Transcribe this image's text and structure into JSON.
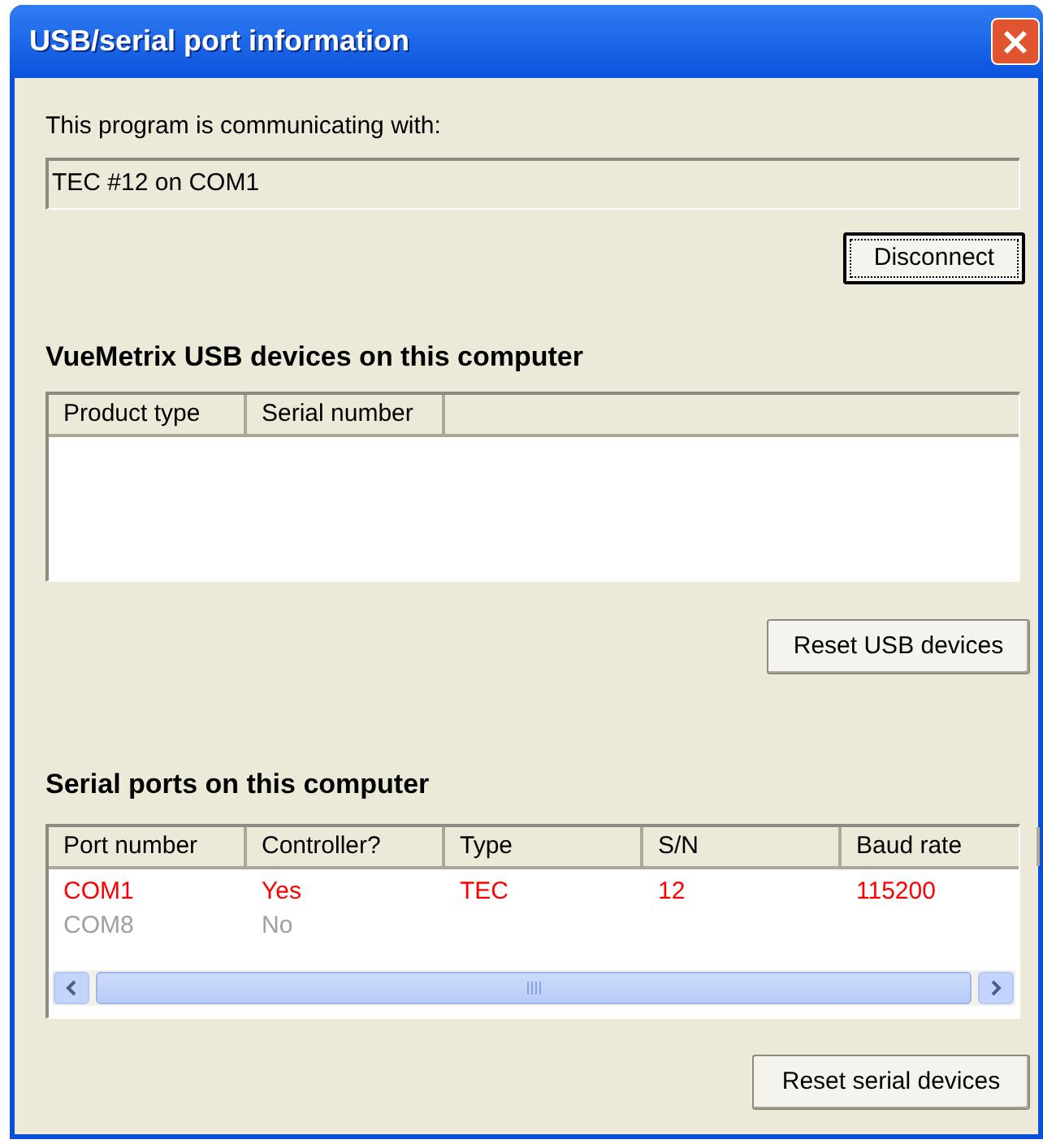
{
  "window": {
    "title": "USB/serial port information"
  },
  "connection": {
    "label": "This program is communicating with:",
    "value": "TEC #12 on COM1"
  },
  "disconnect_button": {
    "label": "Disconnect",
    "focused": true
  },
  "usb_section": {
    "heading": "VueMetrix USB devices on this computer",
    "columns": [
      "Product type",
      "Serial number"
    ],
    "button": {
      "label": "Reset USB devices",
      "focused": false
    }
  },
  "serial_section": {
    "heading": "Serial ports on this computer",
    "columns": [
      "Port number",
      "Controller?",
      "Type",
      "S/N",
      "Baud rate"
    ],
    "rows": [
      {
        "color": "#ff0000",
        "cells": [
          "COM1",
          "Yes",
          "TEC",
          "12",
          "115200"
        ]
      },
      {
        "color": "#a0a0a0",
        "cells": [
          "COM8",
          "No"
        ]
      }
    ],
    "button": {
      "label": "Reset serial devices",
      "focused": false
    }
  }
}
